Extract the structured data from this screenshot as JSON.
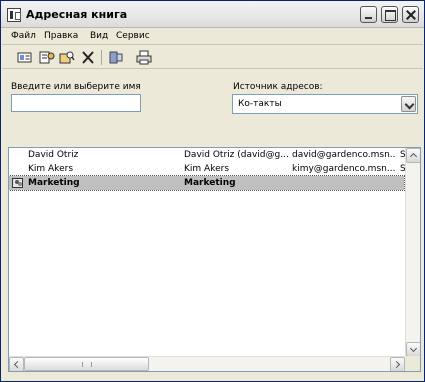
{
  "window": {
    "title": "Адресная книга"
  },
  "menu": [
    "Файл",
    "Правка",
    "Вид",
    "Сервис"
  ],
  "toolbar": {
    "icons": [
      "new-contact-icon",
      "properties-icon",
      "find-icon",
      "delete-icon",
      "send-mail-icon",
      "print-icon"
    ]
  },
  "form": {
    "name_label": "Введите или выберите имя",
    "name_value": "",
    "source_label": "Источник адресов:",
    "source_value": "Ко-такты"
  },
  "list": {
    "rows": [
      {
        "name": "David Otriz",
        "display": "David Otriz (david@g...",
        "email": "david@gardenco.msn....",
        "extra": "S",
        "type": "contact"
      },
      {
        "name": "Kim Akers",
        "display": "Kim Akers",
        "email": "kimy@gardenco.msn....",
        "extra": "S",
        "type": "contact"
      },
      {
        "name": "Marketing",
        "display": "Marketing",
        "email": "",
        "extra": "",
        "type": "group",
        "selected": true
      }
    ]
  }
}
